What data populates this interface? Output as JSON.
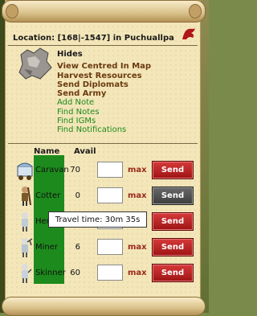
{
  "location": {
    "label": "Location: [168|-1547] in Puchuallpa"
  },
  "resource": {
    "title": "Hides"
  },
  "menu": {
    "items": [
      {
        "label": "View Centred In Map",
        "style": "brown"
      },
      {
        "label": "Harvest Resources",
        "style": "brown"
      },
      {
        "label": "Send Diplomats",
        "style": "brown"
      },
      {
        "label": "Send Army",
        "style": "brown"
      },
      {
        "label": "Add Note",
        "style": "green"
      },
      {
        "label": "Find Notes",
        "style": "green"
      },
      {
        "label": "Find IGMs",
        "style": "green"
      },
      {
        "label": "Find Notifications",
        "style": "green"
      }
    ]
  },
  "table": {
    "headers": {
      "name": "Name",
      "avail": "Avail"
    },
    "rows": [
      {
        "name": "Caravan",
        "avail": "70",
        "max": "max",
        "send": "Send",
        "icon": "caravan-icon"
      },
      {
        "name": "Cotter",
        "avail": "0",
        "max": "max",
        "send": "Send",
        "icon": "cotter-icon"
      },
      {
        "name": "Her",
        "avail": "",
        "max": "max",
        "send": "Send",
        "icon": "herder-icon"
      },
      {
        "name": "Miner",
        "avail": "6",
        "max": "max",
        "send": "Send",
        "icon": "miner-icon"
      },
      {
        "name": "Skinner",
        "avail": "60",
        "max": "max",
        "send": "Send",
        "icon": "skinner-icon"
      }
    ]
  },
  "tooltip": {
    "text": "Travel time: 30m 35s"
  },
  "colors": {
    "link_brown": "#6b3a10",
    "link_green": "#1d8a1d",
    "send_red": "#c22a2a"
  }
}
